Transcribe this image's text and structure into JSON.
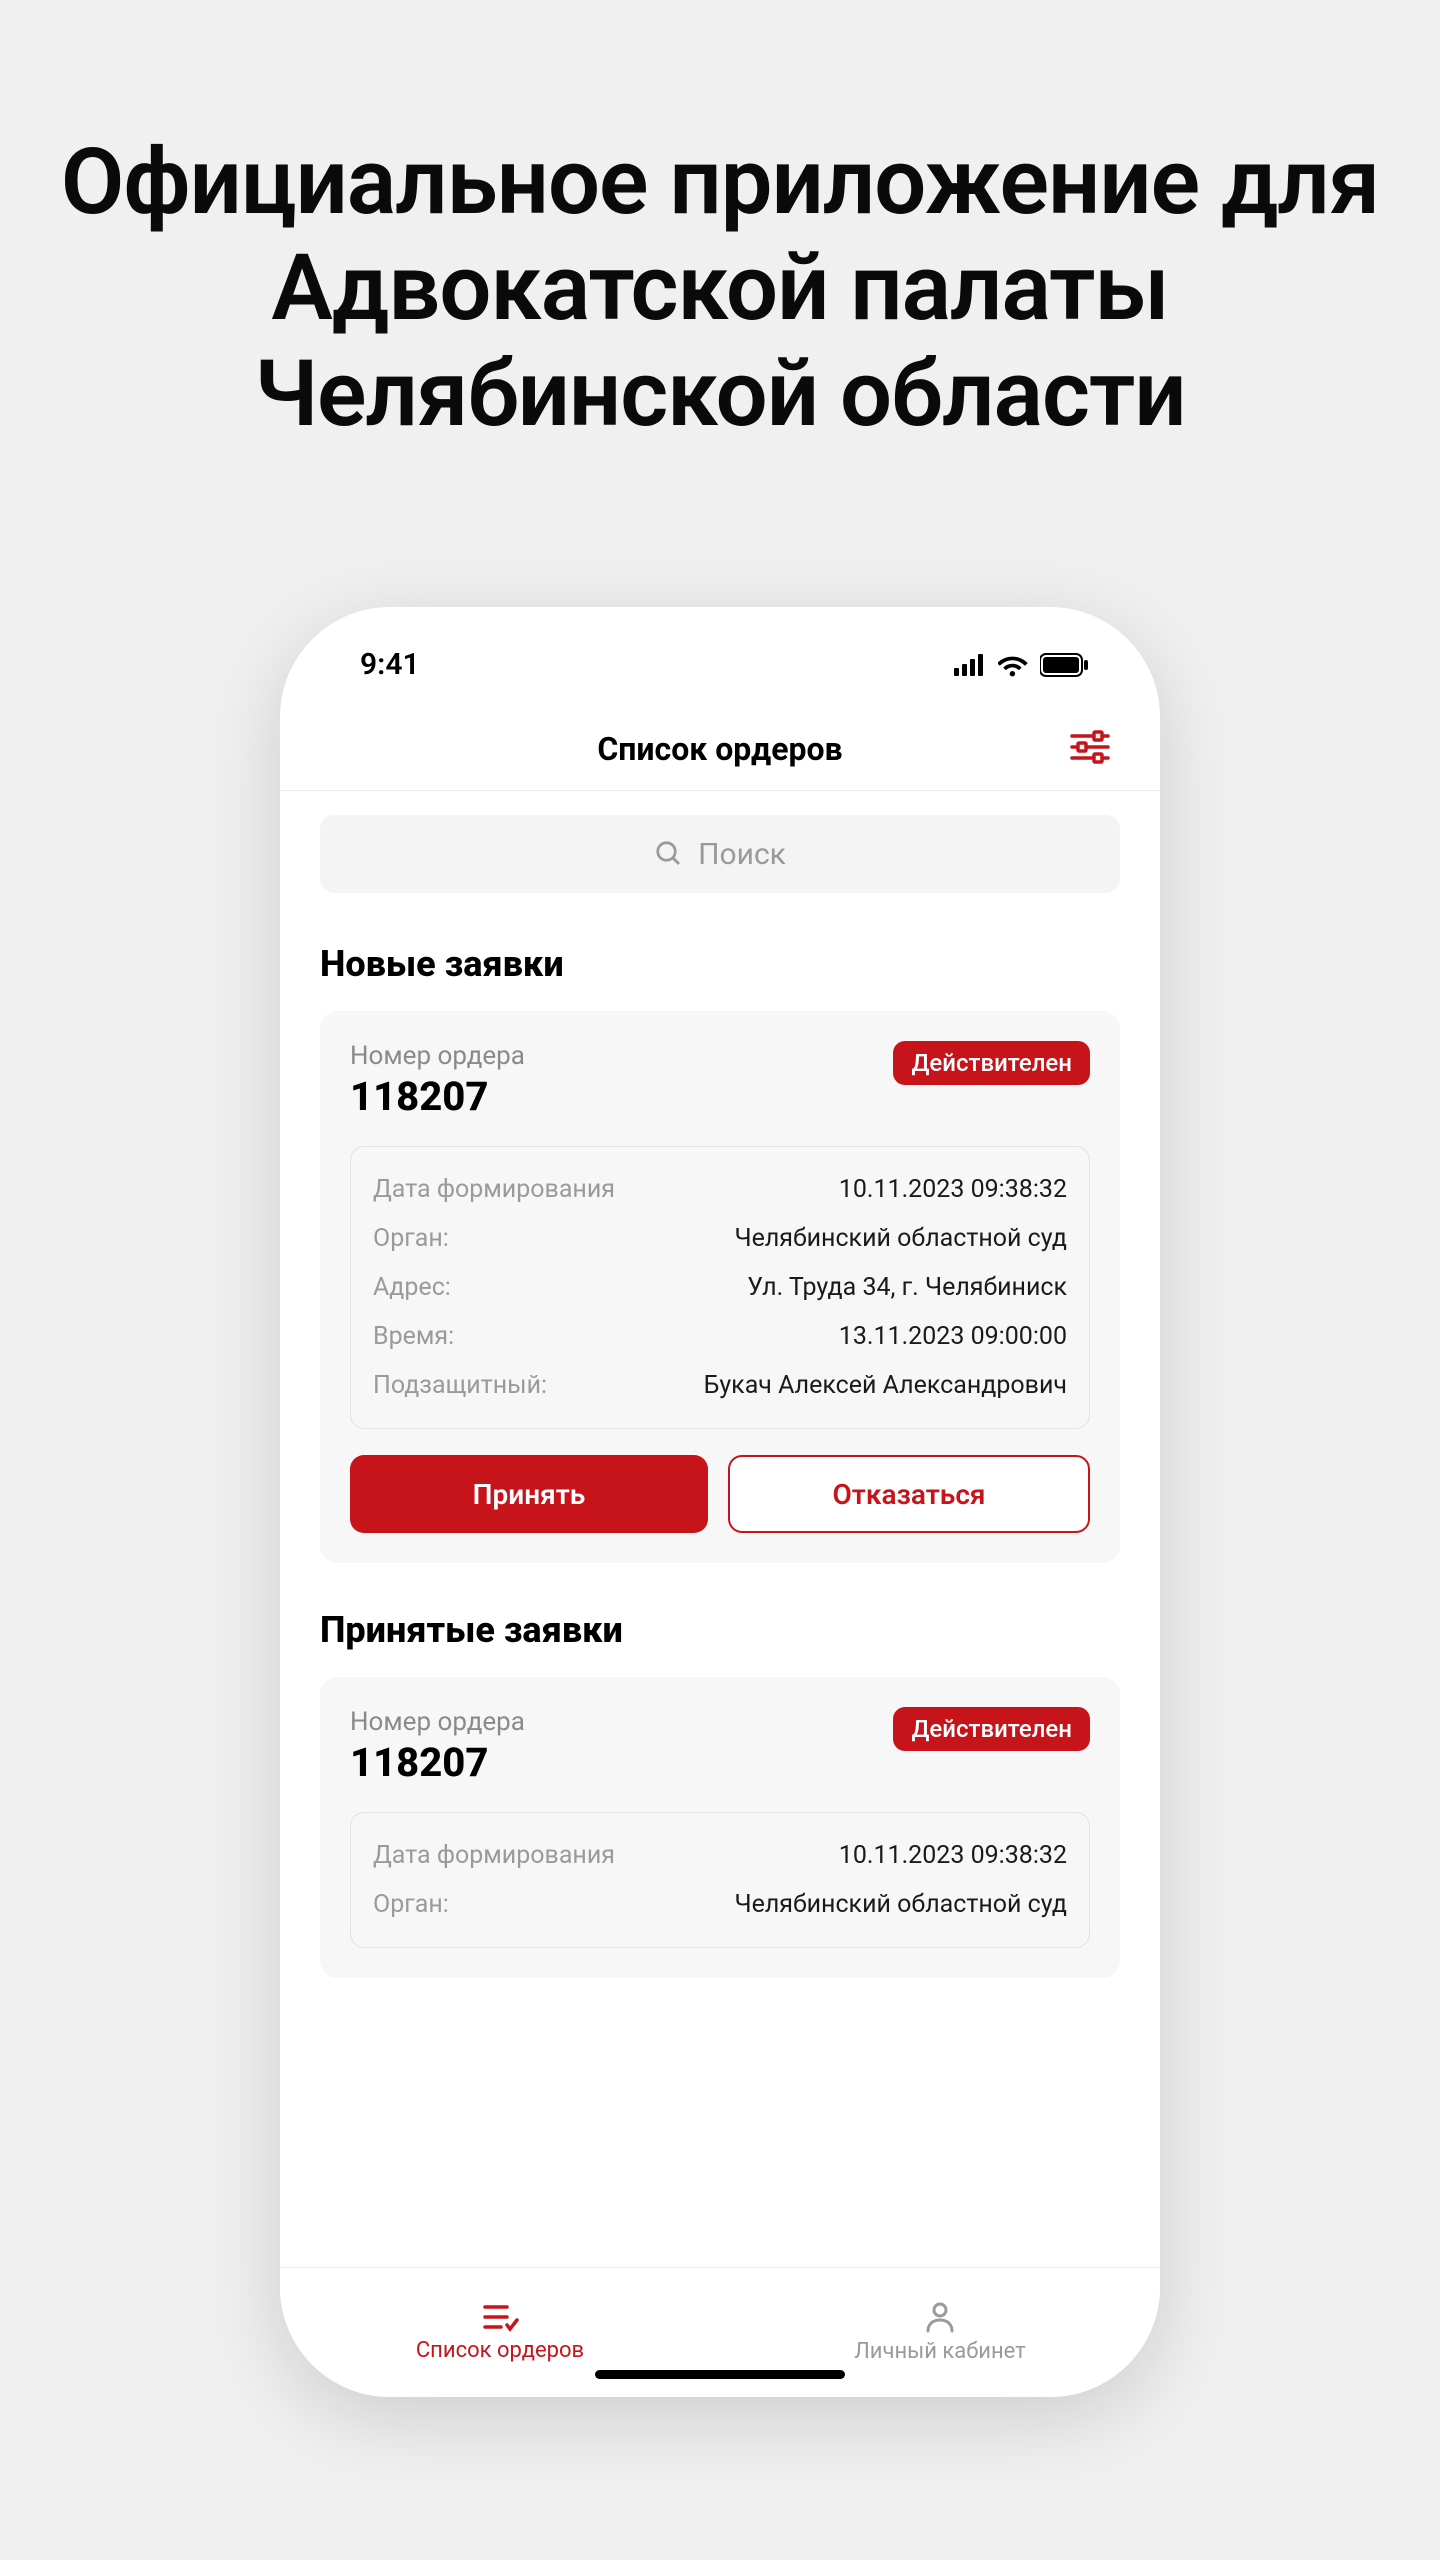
{
  "headline": "Официальное приложение для Адвокатской палаты Челябинской области",
  "status": {
    "time": "9:41"
  },
  "header": {
    "title": "Список ордеров"
  },
  "search": {
    "placeholder": "Поиск"
  },
  "sections": {
    "new": {
      "title": "Новые заявки",
      "card": {
        "order_label": "Номер ордера",
        "order_num": "118207",
        "badge": "Действителен",
        "rows": [
          {
            "label": "Дата формирования",
            "value": "10.11.2023 09:38:32"
          },
          {
            "label": "Орган:",
            "value": "Челябинский областной суд"
          },
          {
            "label": "Адрес:",
            "value": "Ул. Труда 34, г. Челябиниск"
          },
          {
            "label": "Время:",
            "value": "13.11.2023 09:00:00"
          },
          {
            "label": "Подзащитный:",
            "value": "Букач Алексей Александрович"
          }
        ],
        "actions": {
          "accept": "Принять",
          "reject": "Отказаться"
        }
      }
    },
    "accepted": {
      "title": "Принятые заявки",
      "card": {
        "order_label": "Номер ордера",
        "order_num": "118207",
        "badge": "Действителен",
        "rows": [
          {
            "label": "Дата формирования",
            "value": "10.11.2023 09:38:32"
          },
          {
            "label": "Орган:",
            "value": "Челябинский областной суд"
          }
        ]
      }
    }
  },
  "tabs": {
    "orders": "Список ордеров",
    "profile": "Личный кабинет"
  },
  "colors": {
    "accent": "#c7141a"
  }
}
